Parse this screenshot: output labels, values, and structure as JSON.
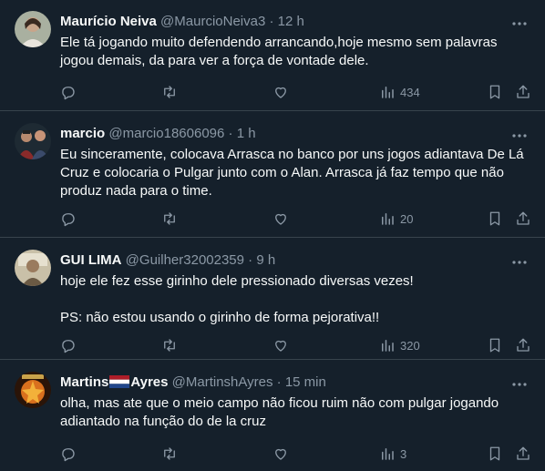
{
  "tweets": [
    {
      "name": "Maurício Neiva",
      "handle": "@MaurcioNeiva3",
      "time": "12 h",
      "text": "Ele tá jogando muito defendendo arrancando,hoje mesmo sem palavras\njogou demais, da para ver a força de vontade dele.",
      "views": "434"
    },
    {
      "name": "marcio",
      "handle": "@marcio18606096",
      "time": "1 h",
      "text": "Eu sinceramente, colocava Arrasca no banco por uns jogos adiantava De Lá\nCruz e colocaria o Pulgar junto com o Alan. Arrasca já faz tempo que não\nproduz nada para o time.",
      "views": "20"
    },
    {
      "name": "GUI LIMA",
      "handle": "@Guilher32002359",
      "time": "9 h",
      "text": "hoje ele fez esse girinho dele pressionado diversas vezes!\n\nPS: não estou usando o girinho de forma pejorativa!!",
      "views": "320"
    },
    {
      "name": "Martins",
      "name_suffix": "Ayres",
      "handle": "@MartinshAyres",
      "time": "15 min",
      "text": "olha, mas ate que o meio campo não ficou ruim não com pulgar jogando\nadiantado na função do de la cruz",
      "views": "3"
    }
  ],
  "dot": "·",
  "colors": {
    "background": "#15202b",
    "muted": "#8b98a5",
    "divider": "#38444d"
  }
}
